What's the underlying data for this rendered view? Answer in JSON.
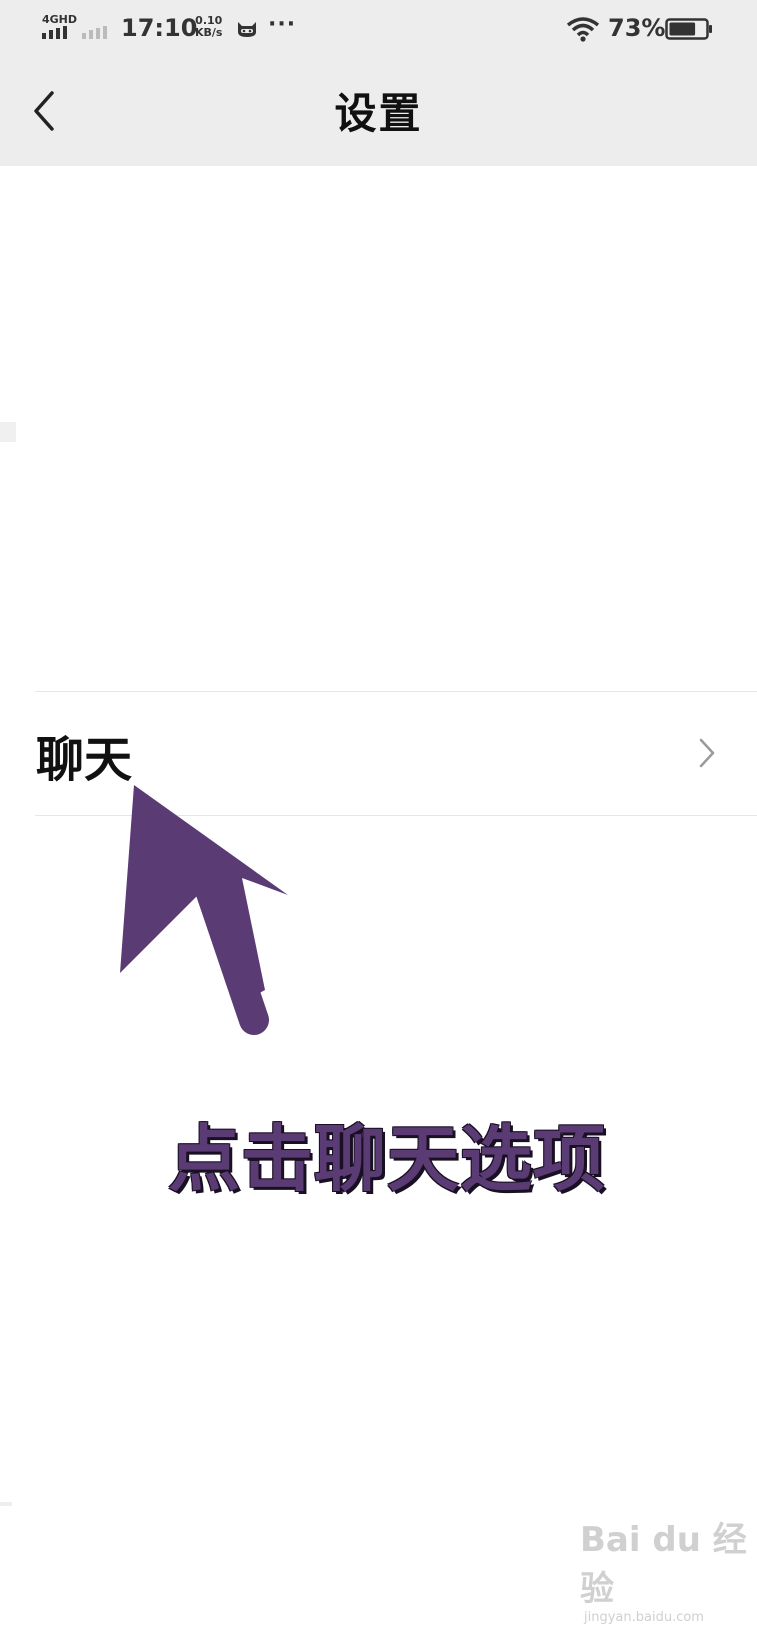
{
  "status_bar": {
    "network": "4GHD",
    "time": "17:10",
    "speed_value": "0.10",
    "speed_unit": "KB/s",
    "more": "···",
    "battery_percent": "73%",
    "battery_level": 0.73,
    "icons": [
      "signal-icon",
      "cat-icon",
      "wifi-icon",
      "battery-icon"
    ]
  },
  "nav": {
    "title": "设置",
    "back_icon": "chevron-left-icon"
  },
  "settings_list": {
    "items": [
      {
        "label": "聊天",
        "icon": "chevron-right-icon"
      }
    ]
  },
  "annotation": {
    "text": "点击聊天选项",
    "color": "#5b3b74"
  },
  "watermark": {
    "main": "Bai du 经验",
    "sub": "jingyan.baidu.com"
  }
}
